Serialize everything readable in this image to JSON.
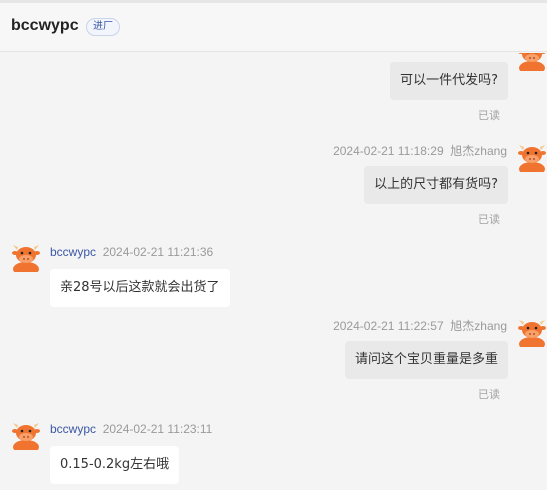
{
  "header": {
    "name": "bccwypc",
    "badge": "进厂"
  },
  "messages": [
    {
      "dir": "out",
      "text": "可以一件代发吗?",
      "read": "已读"
    },
    {
      "dir": "out",
      "time": "2024-02-21 11:18:29",
      "sender": "旭杰zhang",
      "text": "以上的尺寸都有货吗?",
      "read": "已读"
    },
    {
      "dir": "in",
      "time": "2024-02-21 11:21:36",
      "sender": "bccwypc",
      "text": "亲28号以后这款就会出货了"
    },
    {
      "dir": "out",
      "time": "2024-02-21 11:22:57",
      "sender": "旭杰zhang",
      "text": "请问这个宝贝重量是多重",
      "read": "已读"
    },
    {
      "dir": "in",
      "time": "2024-02-21 11:23:11",
      "sender": "bccwypc",
      "text": "0.15-0.2kg左右哦"
    }
  ],
  "colors": {
    "accent": "#3b57a6",
    "avatar": "#f0742f"
  },
  "icons": {
    "avatar": "cartoon-cow-avatar-icon"
  }
}
